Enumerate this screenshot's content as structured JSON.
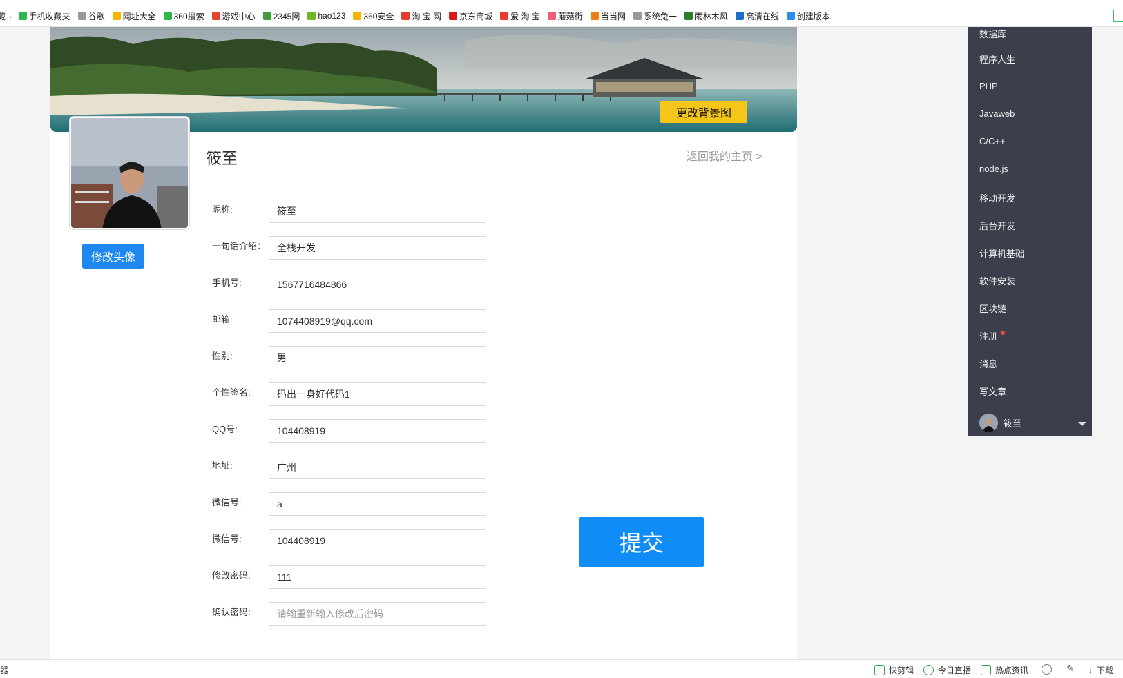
{
  "bookmarks": {
    "first": "藏",
    "items": [
      {
        "label": "手机收藏夹",
        "color": "#2db84d"
      },
      {
        "label": "谷歌",
        "color": "#999999"
      },
      {
        "label": "网址大全",
        "color": "#f5b400"
      },
      {
        "label": "360搜索",
        "color": "#2db84d"
      },
      {
        "label": "游戏中心",
        "color": "#e8412c"
      },
      {
        "label": "2345网",
        "color": "#3c9d3c"
      },
      {
        "label": "hao123",
        "color": "#6fb62c"
      },
      {
        "label": "360安全",
        "color": "#f5b400"
      },
      {
        "label": "淘 宝 网",
        "color": "#e63b2e"
      },
      {
        "label": "京东商城",
        "color": "#d71a1a"
      },
      {
        "label": "爱 淘 宝",
        "color": "#e63b2e"
      },
      {
        "label": "蘑菇街",
        "color": "#f05a7e"
      },
      {
        "label": "当当网",
        "color": "#f07d1a"
      },
      {
        "label": "系统兔一",
        "color": "#999999"
      },
      {
        "label": "雨林木风",
        "color": "#2b7d2b"
      },
      {
        "label": "高清在线",
        "color": "#1a6fc2"
      },
      {
        "label": "创建版本",
        "color": "#2b8ef0"
      }
    ]
  },
  "profile": {
    "change_background_label": "更改背景图",
    "change_avatar_label": "修改头像",
    "username": "筱至",
    "back_home_label": "返回我的主页 >"
  },
  "form": {
    "fields": [
      {
        "label": "昵称:",
        "value": "筱至",
        "placeholder": ""
      },
      {
        "label": "一句话介绍：",
        "value": "全栈开发",
        "placeholder": ""
      },
      {
        "label": "手机号:",
        "value": "1567716484866",
        "placeholder": ""
      },
      {
        "label": "邮箱:",
        "value": "1074408919@qq.com",
        "placeholder": ""
      },
      {
        "label": "性别:",
        "value": "男",
        "placeholder": ""
      },
      {
        "label": "个性签名:",
        "value": "码出一身好代码1",
        "placeholder": ""
      },
      {
        "label": "QQ号:",
        "value": "104408919",
        "placeholder": ""
      },
      {
        "label": "地址:",
        "value": "广州",
        "placeholder": ""
      },
      {
        "label": "微信号:",
        "value": "a",
        "placeholder": ""
      },
      {
        "label": "微信号:",
        "value": "104408919",
        "placeholder": ""
      },
      {
        "label": "修改密码:",
        "value": "111",
        "placeholder": ""
      },
      {
        "label": "确认密码:",
        "value": "",
        "placeholder": "请输重新输入修改后密码"
      }
    ],
    "submit_label": "提交"
  },
  "sidemenu": {
    "items": [
      "数据库",
      "程序人生",
      "PHP",
      "Javaweb",
      "C/C++",
      "node.js",
      "移动开发",
      "后台开发",
      "计算机基础",
      "软件安装",
      "区块链",
      "注册",
      "消息",
      "写文章"
    ],
    "user_name": "筱至"
  },
  "statusbar": {
    "left_char": "器",
    "items": [
      {
        "label": "快剪辑",
        "icon": "play-square-icon"
      },
      {
        "label": "今日直播",
        "icon": "play-circle-icon"
      },
      {
        "label": "热点资讯",
        "icon": "news-icon"
      },
      {
        "label": "下载",
        "icon": "download-icon"
      }
    ]
  },
  "colors": {
    "primary_blue": "#1e88f0",
    "submit_blue": "#0f8cf5",
    "yellow_button": "#f5c518",
    "menu_bg": "#3a3f4b",
    "notify_dot": "#f04d3b"
  }
}
